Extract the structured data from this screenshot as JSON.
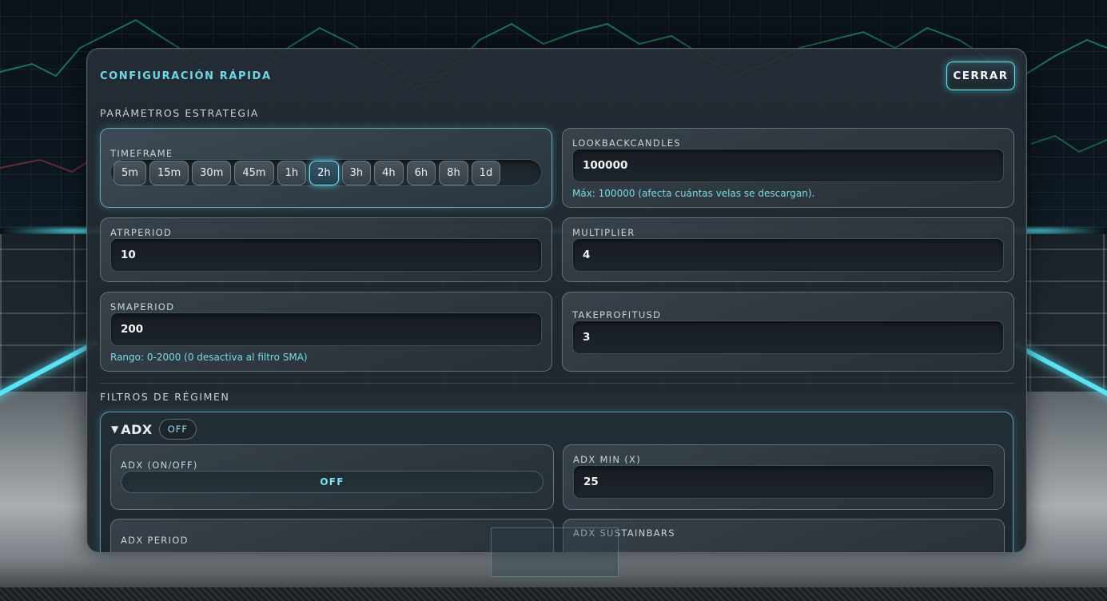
{
  "header": {
    "title": "CONFIGURACIÓN RÁPIDA",
    "close_label": "CERRAR"
  },
  "sections": {
    "strategy_title": "PARÁMETROS ESTRATEGIA",
    "regime_title": "FILTROS DE RÉGIMEN"
  },
  "timeframe": {
    "label": "TIMEFRAME",
    "options": [
      "5m",
      "15m",
      "30m",
      "45m",
      "1h",
      "2h",
      "3h",
      "4h",
      "6h",
      "8h",
      "1d"
    ],
    "selected": "2h"
  },
  "lookback": {
    "label": "LOOKBACKCANDLES",
    "value": "100000",
    "hint": "Máx: 100000 (afecta cuántas velas se descargan)."
  },
  "atr": {
    "label": "ATRPERIOD",
    "value": "10"
  },
  "multiplier": {
    "label": "MULTIPLIER",
    "value": "4"
  },
  "sma": {
    "label": "SMAPERIOD",
    "value": "200",
    "hint": "Rango: 0-2000 (0 desactiva al filtro SMA)"
  },
  "takeprofit": {
    "label": "TAKEPROFITUSD",
    "value": "3"
  },
  "adx": {
    "title": "ADX",
    "badge": "OFF",
    "onoff_label": "ADX (ON/OFF)",
    "onoff_value": "OFF",
    "min_label": "ADX MIN (X)",
    "min_value": "25",
    "period_label": "ADX PERIOD",
    "sustain_label": "ADX SUSTAINBARS"
  },
  "colors": {
    "accent": "#6fd8e8",
    "panel": "#262e36",
    "field": "#1a2026"
  }
}
